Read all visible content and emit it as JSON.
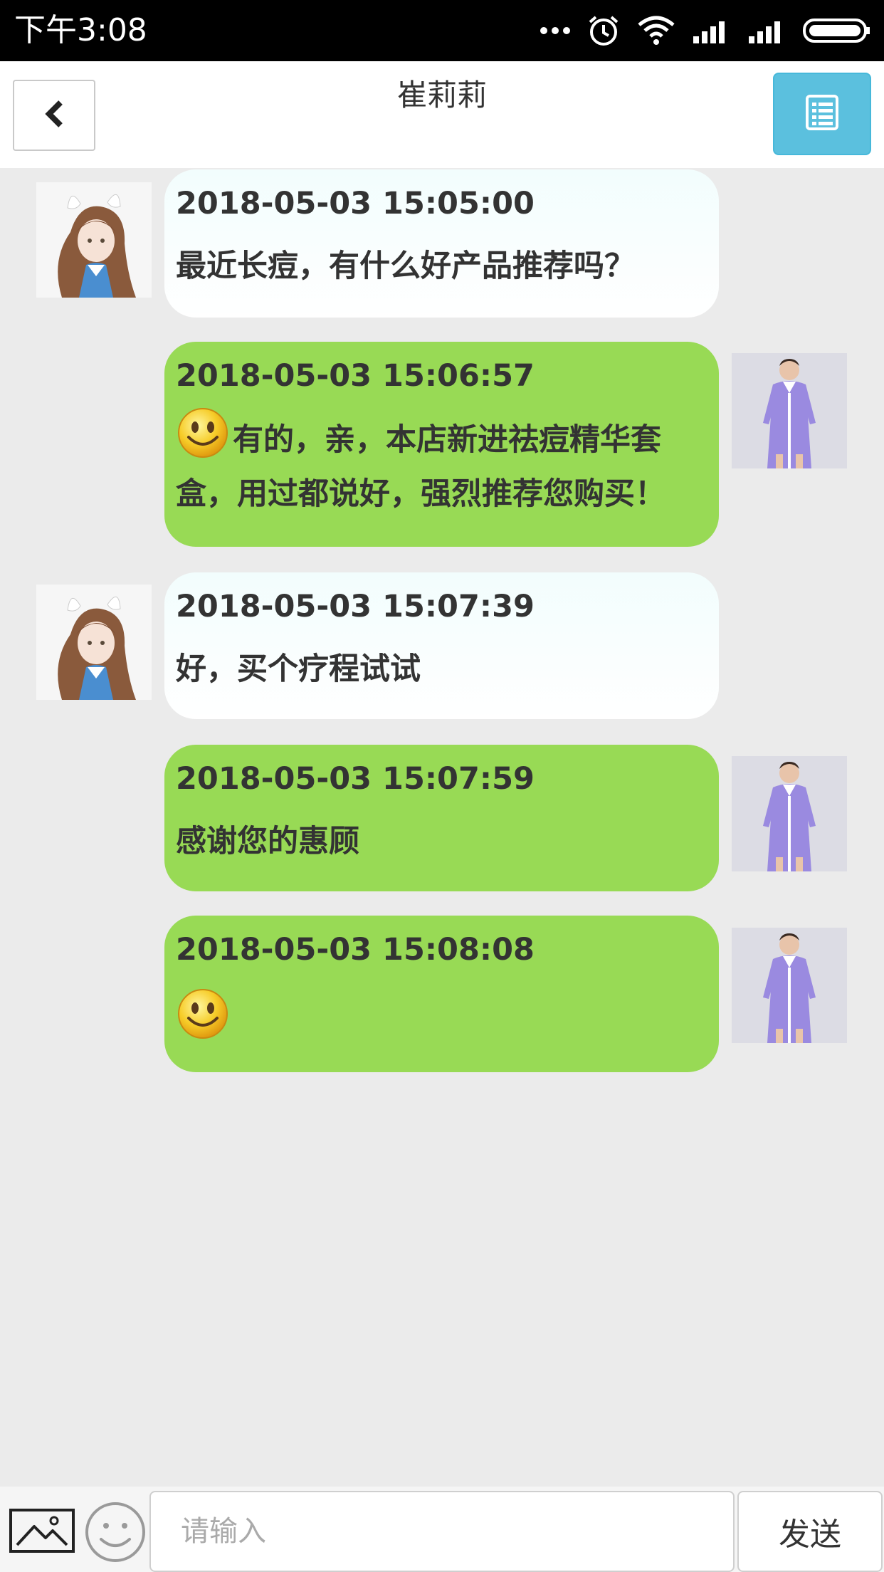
{
  "status_bar": {
    "time": "下午3:08"
  },
  "header": {
    "title": "崔莉莉"
  },
  "messages": [
    {
      "side": "in",
      "time": "2018-05-03 15:05:00",
      "text": "最近长痘，有什么好产品推荐吗？",
      "emoji": false
    },
    {
      "side": "out",
      "time": "2018-05-03 15:06:57",
      "text": "有的，亲，本店新进祛痘精华套盒，用过都说好，强烈推荐您购买！",
      "emoji": true
    },
    {
      "side": "in",
      "time": "2018-05-03 15:07:39",
      "text": "好，买个疗程试试",
      "emoji": false
    },
    {
      "side": "out",
      "time": "2018-05-03 15:07:59",
      "text": "感谢您的惠顾",
      "emoji": false
    },
    {
      "side": "out",
      "time": "2018-05-03 15:08:08",
      "text": "",
      "emoji": true
    }
  ],
  "input_bar": {
    "placeholder": "请输入",
    "send_label": "发送"
  },
  "colors": {
    "accent": "#5bc0de",
    "out_bubble": "#98da55",
    "in_bubble": "#f4fdfd",
    "background": "#ebebeb"
  },
  "icons": {
    "back": "chevron-left-icon",
    "menu": "list-icon",
    "image": "image-icon",
    "emoji": "smiley-face-icon"
  }
}
